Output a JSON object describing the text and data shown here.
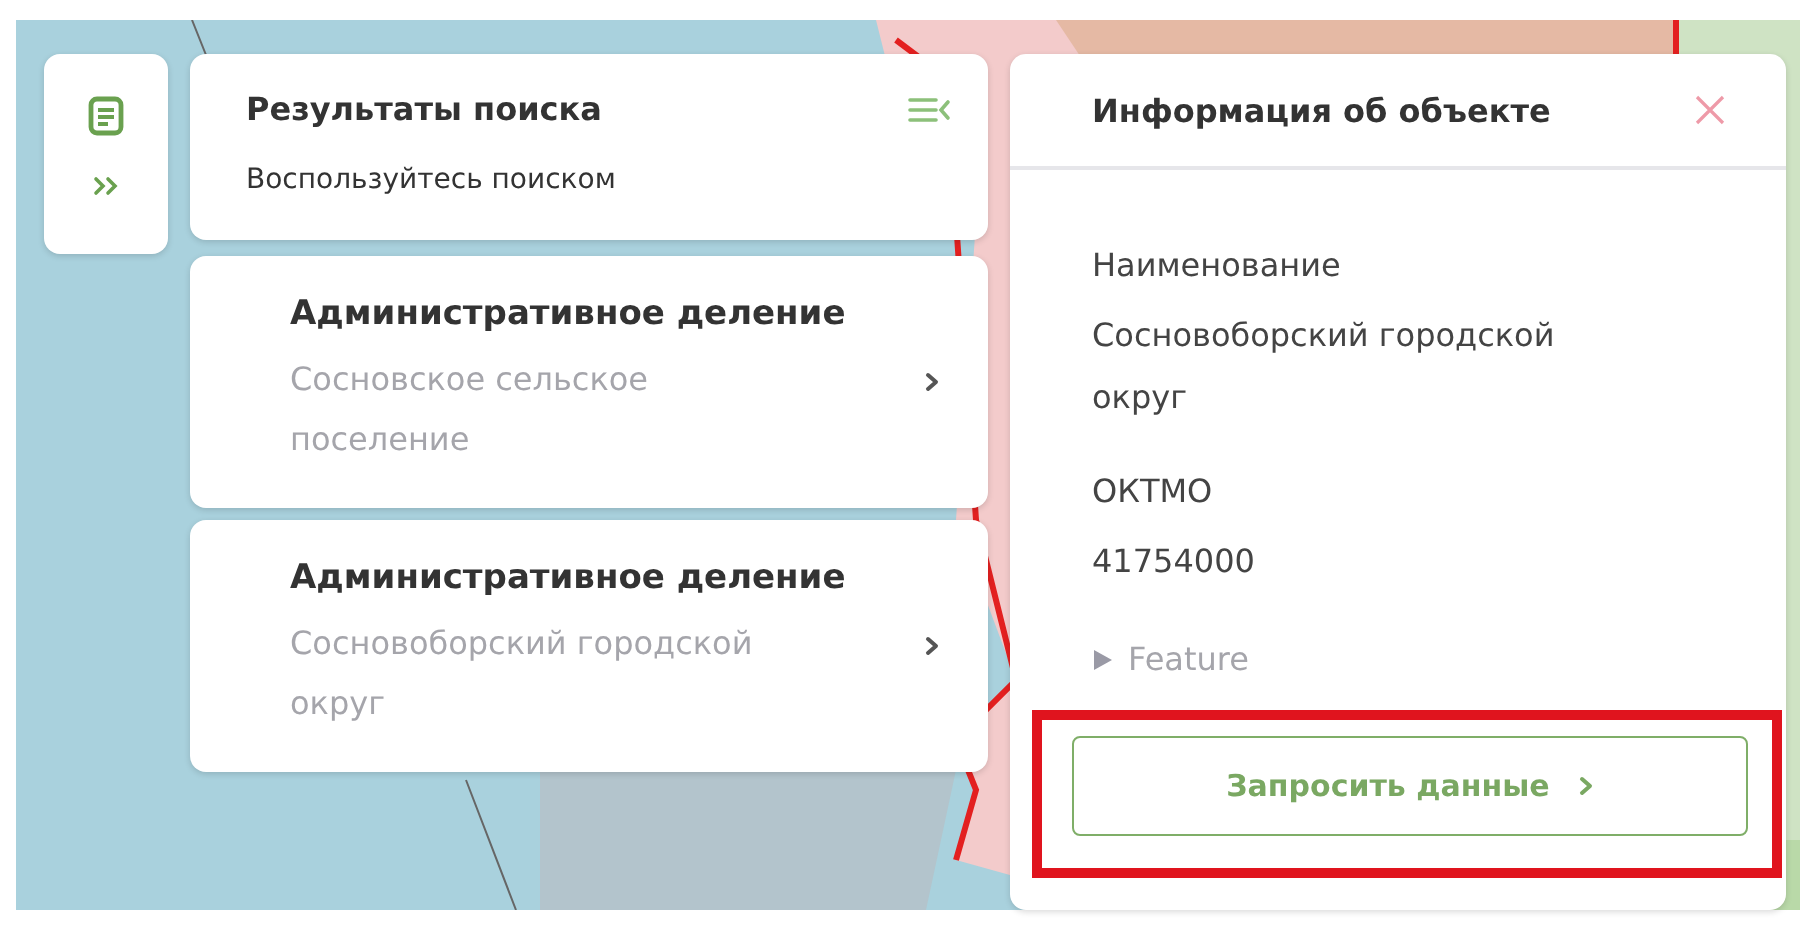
{
  "search": {
    "title": "Результаты поиска",
    "hint": "Воспользуйтесь поиском"
  },
  "results": [
    {
      "category": "Административное деление",
      "name": "Сосновское сельское поселение"
    },
    {
      "category": "Административное деление",
      "name": "Сосновоборский городской округ"
    }
  ],
  "info": {
    "title": "Информация об объекте",
    "fields": [
      {
        "label": "Наименование",
        "value": "Сосновоборский городской округ"
      },
      {
        "label": "ОКТМО",
        "value": "41754000"
      }
    ],
    "details": {
      "label": "Feature",
      "expanded": false
    },
    "action": {
      "label": "Запросить данные",
      "highlighted": true
    }
  }
}
